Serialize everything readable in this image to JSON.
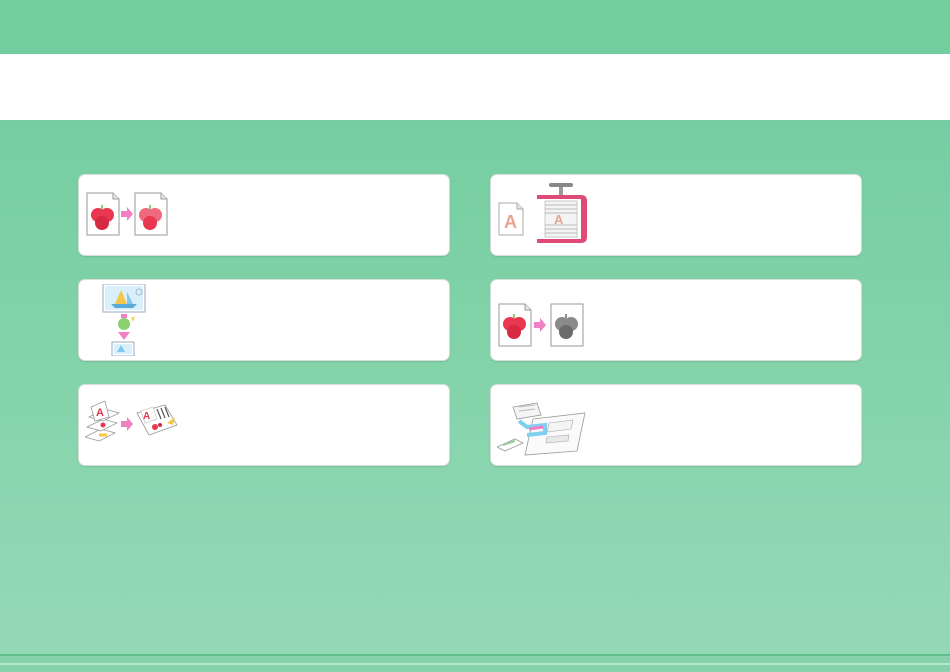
{
  "header": {
    "title": ""
  },
  "cards": [
    {
      "label": "",
      "icon": "scan-to-color-icon"
    },
    {
      "label": "",
      "icon": "image-resize-icon"
    },
    {
      "label": "",
      "icon": "combine-pages-icon"
    },
    {
      "label": "",
      "icon": "compress-file-icon"
    },
    {
      "label": "",
      "icon": "color-to-grayscale-icon"
    },
    {
      "label": "",
      "icon": "document-network-icon"
    }
  ],
  "colors": {
    "top_bar": "#72cd9f",
    "background": "#8fd6b1",
    "card": "#ffffff",
    "accent_pink": "#f27fc5",
    "apple_red": "#e8374f"
  }
}
